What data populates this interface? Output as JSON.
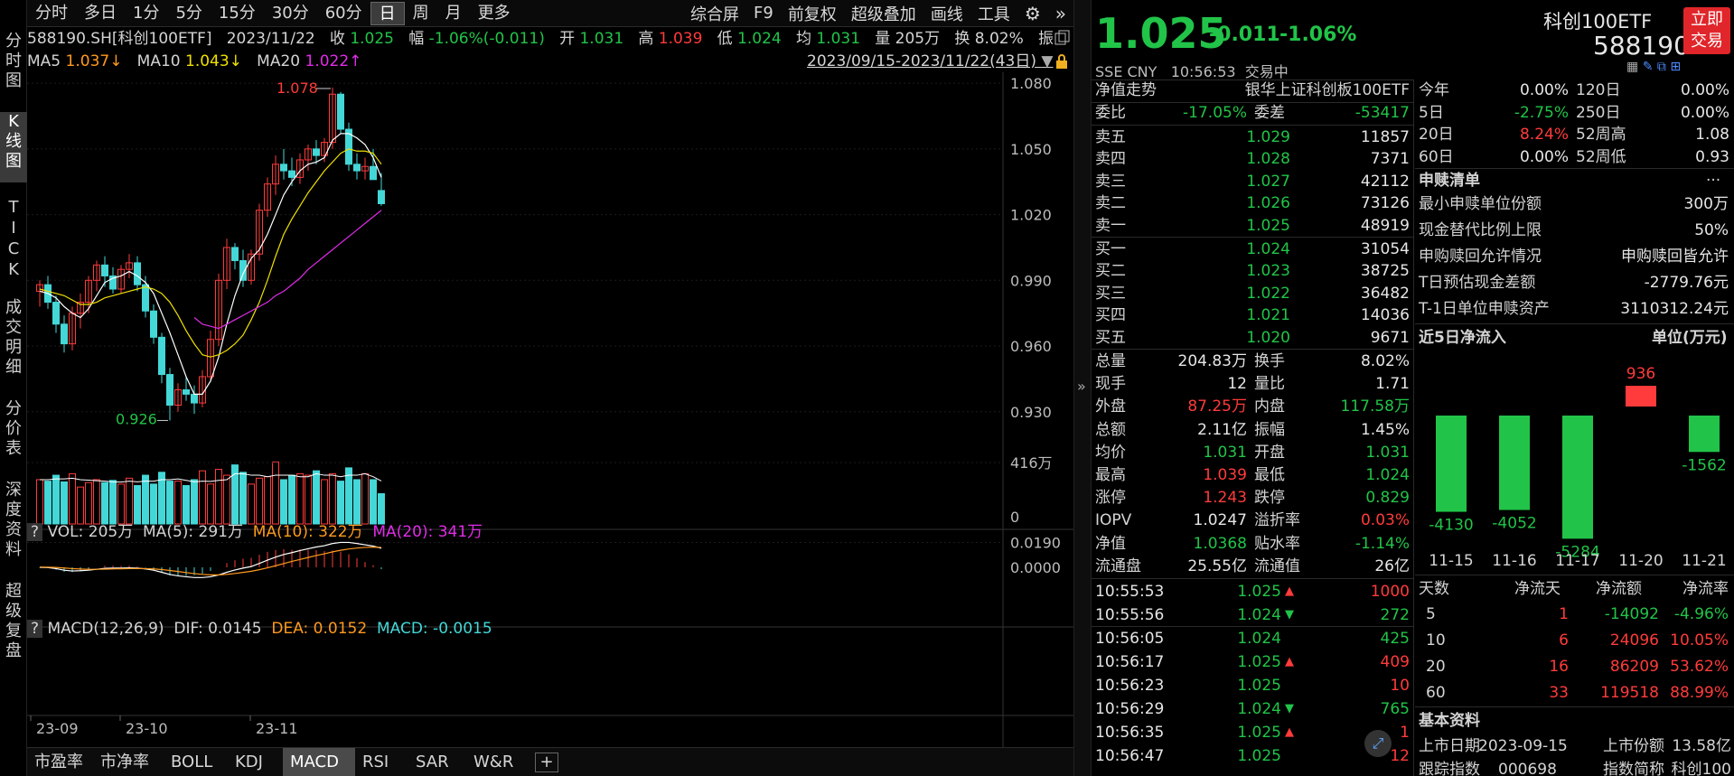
{
  "left_tabs": [
    "分时图",
    "K线图",
    "TICK",
    "成交明细",
    "分价表",
    "深度资料",
    "超级复盘"
  ],
  "top": {
    "periods": [
      "分时",
      "多日",
      "1分",
      "5分",
      "15分",
      "30分",
      "60分",
      "日",
      "周",
      "月",
      "更多"
    ],
    "active_period": "日",
    "tools": [
      "综合屏",
      "F9",
      "前复权",
      "超级叠加",
      "画线",
      "工具"
    ]
  },
  "info": {
    "code": "588190.SH[科创100ETF]",
    "date": "2023/11/22",
    "close_l": "收",
    "close": "1.025",
    "chg_l": "幅",
    "chg": "-1.06%(-0.011)",
    "open_l": "开",
    "open": "1.031",
    "high_l": "高",
    "high": "1.039",
    "low_l": "低",
    "low": "1.024",
    "avg_l": "均",
    "avg": "1.031",
    "vol_l": "量",
    "vol": "205万",
    "turn_l": "换",
    "turn": "8.02%",
    "amp_l": "振"
  },
  "ma_line": {
    "ma5_l": "MA5",
    "ma5": "1.037↓",
    "ma10_l": "MA10",
    "ma10": "1.043↓",
    "ma20_l": "MA20",
    "ma20": "1.022↑",
    "range": "2023/09/15-2023/11/22(43日)"
  },
  "price_axis": [
    "1.080",
    "1.050",
    "1.020",
    "0.990",
    "0.960",
    "0.930"
  ],
  "annot": {
    "high": "1.078",
    "low": "0.926"
  },
  "vol_panel": {
    "q": "?",
    "vol": "VOL: 205万",
    "ma5": "MA(5): 291万",
    "ma10": "MA(10): 322万",
    "ma20": "MA(20): 341万",
    "axis_top": "416万",
    "axis_zero": "0"
  },
  "macd_panel": {
    "q": "?",
    "label": "MACD(12,26,9)",
    "dif": "DIF: 0.0145",
    "dea": "DEA: 0.0152",
    "macd": "MACD: -0.0015",
    "axis_top": "0.0190",
    "axis_zero": "0.0000"
  },
  "x_axis": [
    "23-09",
    "23-10",
    "23-11"
  ],
  "bottom_tabs": [
    "市盈率",
    "市净率",
    "BOLL",
    "KDJ",
    "MACD",
    "RSI",
    "SAR",
    "W&R"
  ],
  "bottom_active": "MACD",
  "chart_data": {
    "type": "candlestick",
    "series_names": [
      "MA5",
      "MA10",
      "MA20"
    ],
    "candles": [
      {
        "o": 0.985,
        "h": 0.99,
        "l": 0.978,
        "c": 0.988
      },
      {
        "o": 0.988,
        "h": 0.992,
        "l": 0.977,
        "c": 0.98
      },
      {
        "o": 0.98,
        "h": 0.983,
        "l": 0.966,
        "c": 0.97
      },
      {
        "o": 0.97,
        "h": 0.974,
        "l": 0.957,
        "c": 0.961
      },
      {
        "o": 0.961,
        "h": 0.978,
        "l": 0.958,
        "c": 0.975
      },
      {
        "o": 0.975,
        "h": 0.984,
        "l": 0.968,
        "c": 0.98
      },
      {
        "o": 0.98,
        "h": 0.992,
        "l": 0.975,
        "c": 0.99
      },
      {
        "o": 0.99,
        "h": 0.999,
        "l": 0.985,
        "c": 0.997
      },
      {
        "o": 0.997,
        "h": 1.001,
        "l": 0.987,
        "c": 0.992
      },
      {
        "o": 0.992,
        "h": 0.996,
        "l": 0.984,
        "c": 0.986
      },
      {
        "o": 0.986,
        "h": 0.997,
        "l": 0.984,
        "c": 0.995
      },
      {
        "o": 0.995,
        "h": 1.002,
        "l": 0.991,
        "c": 0.998
      },
      {
        "o": 0.998,
        "h": 1.001,
        "l": 0.985,
        "c": 0.988
      },
      {
        "o": 0.988,
        "h": 0.992,
        "l": 0.973,
        "c": 0.976
      },
      {
        "o": 0.976,
        "h": 0.979,
        "l": 0.961,
        "c": 0.964
      },
      {
        "o": 0.964,
        "h": 0.966,
        "l": 0.943,
        "c": 0.947
      },
      {
        "o": 0.947,
        "h": 0.95,
        "l": 0.926,
        "c": 0.933
      },
      {
        "o": 0.933,
        "h": 0.943,
        "l": 0.93,
        "c": 0.94
      },
      {
        "o": 0.94,
        "h": 0.946,
        "l": 0.935,
        "c": 0.938
      },
      {
        "o": 0.938,
        "h": 0.942,
        "l": 0.929,
        "c": 0.934
      },
      {
        "o": 0.934,
        "h": 0.949,
        "l": 0.932,
        "c": 0.946
      },
      {
        "o": 0.946,
        "h": 0.967,
        "l": 0.944,
        "c": 0.963
      },
      {
        "o": 0.963,
        "h": 0.993,
        "l": 0.96,
        "c": 0.99
      },
      {
        "o": 0.99,
        "h": 1.009,
        "l": 0.986,
        "c": 1.005
      },
      {
        "o": 1.005,
        "h": 1.007,
        "l": 0.995,
        "c": 0.999
      },
      {
        "o": 0.999,
        "h": 1.004,
        "l": 0.987,
        "c": 0.99
      },
      {
        "o": 0.99,
        "h": 1.004,
        "l": 0.988,
        "c": 1.002
      },
      {
        "o": 1.002,
        "h": 1.025,
        "l": 0.999,
        "c": 1.022
      },
      {
        "o": 1.022,
        "h": 1.037,
        "l": 1.019,
        "c": 1.034
      },
      {
        "o": 1.034,
        "h": 1.047,
        "l": 1.029,
        "c": 1.043
      },
      {
        "o": 1.043,
        "h": 1.05,
        "l": 1.036,
        "c": 1.04
      },
      {
        "o": 1.04,
        "h": 1.046,
        "l": 1.033,
        "c": 1.037
      },
      {
        "o": 1.037,
        "h": 1.048,
        "l": 1.034,
        "c": 1.045
      },
      {
        "o": 1.045,
        "h": 1.052,
        "l": 1.04,
        "c": 1.05
      },
      {
        "o": 1.05,
        "h": 1.054,
        "l": 1.043,
        "c": 1.047
      },
      {
        "o": 1.047,
        "h": 1.055,
        "l": 1.044,
        "c": 1.053
      },
      {
        "o": 1.053,
        "h": 1.078,
        "l": 1.05,
        "c": 1.075
      },
      {
        "o": 1.075,
        "h": 1.076,
        "l": 1.057,
        "c": 1.059
      },
      {
        "o": 1.059,
        "h": 1.062,
        "l": 1.04,
        "c": 1.043
      },
      {
        "o": 1.043,
        "h": 1.048,
        "l": 1.036,
        "c": 1.04
      },
      {
        "o": 1.04,
        "h": 1.046,
        "l": 1.036,
        "c": 1.042
      },
      {
        "o": 1.042,
        "h": 1.05,
        "l": 1.038,
        "c": 1.036
      },
      {
        "o": 1.031,
        "h": 1.039,
        "l": 1.024,
        "c": 1.025
      }
    ],
    "ma5": [
      0.985,
      0.984,
      0.982,
      0.978,
      0.975,
      0.973,
      0.977,
      0.983,
      0.989,
      0.991,
      0.992,
      0.994,
      0.992,
      0.989,
      0.984,
      0.975,
      0.966,
      0.956,
      0.946,
      0.938,
      0.938,
      0.944,
      0.955,
      0.97,
      0.983,
      0.993,
      1.0,
      1.004,
      1.011,
      1.02,
      1.029,
      1.035,
      1.04,
      1.043,
      1.044,
      1.046,
      1.054,
      1.057,
      1.057,
      1.055,
      1.052,
      1.046,
      1.037
    ],
    "ma10": [
      0.986,
      0.985,
      0.984,
      0.983,
      0.981,
      0.979,
      0.979,
      0.98,
      0.982,
      0.983,
      0.984,
      0.985,
      0.986,
      0.987,
      0.986,
      0.984,
      0.98,
      0.974,
      0.967,
      0.961,
      0.956,
      0.955,
      0.956,
      0.958,
      0.961,
      0.965,
      0.972,
      0.98,
      0.99,
      1.001,
      1.011,
      1.018,
      1.024,
      1.03,
      1.035,
      1.04,
      1.044,
      1.048,
      1.05,
      1.049,
      1.049,
      1.048,
      1.043
    ],
    "ma20": [
      null,
      null,
      null,
      null,
      null,
      null,
      null,
      null,
      null,
      null,
      null,
      null,
      null,
      null,
      null,
      null,
      null,
      null,
      null,
      0.973,
      0.97,
      0.969,
      0.968,
      0.97,
      0.972,
      0.974,
      0.976,
      0.978,
      0.98,
      0.983,
      0.985,
      0.988,
      0.991,
      0.995,
      0.998,
      1.001,
      1.004,
      1.007,
      1.01,
      1.013,
      1.016,
      1.019,
      1.022
    ],
    "volume_wan": [
      300,
      290,
      330,
      285,
      340,
      250,
      280,
      300,
      280,
      295,
      270,
      310,
      260,
      330,
      270,
      350,
      290,
      290,
      260,
      300,
      360,
      270,
      370,
      330,
      400,
      350,
      270,
      310,
      320,
      420,
      300,
      330,
      340,
      330,
      360,
      300,
      340,
      290,
      380,
      300,
      340,
      300,
      205
    ],
    "vol_ma5_wan": [
      300,
      300,
      305,
      305,
      310,
      300,
      297,
      293,
      290,
      285,
      284,
      290,
      285,
      290,
      290,
      300,
      300,
      305,
      295,
      285,
      290,
      288,
      295,
      300,
      340,
      340,
      330,
      330,
      320,
      330,
      330,
      330,
      320,
      320,
      340,
      330,
      330,
      320,
      330,
      330,
      340,
      320,
      291
    ],
    "dif": [
      0.0,
      -0.0002,
      -0.001,
      -0.0022,
      -0.0028,
      -0.0026,
      -0.0022,
      -0.0015,
      -0.0008,
      -0.0006,
      -0.0006,
      -0.0004,
      -0.0006,
      -0.0012,
      -0.0022,
      -0.0038,
      -0.0055,
      -0.0065,
      -0.0072,
      -0.0078,
      -0.0078,
      -0.0072,
      -0.0058,
      -0.0038,
      -0.002,
      -0.0006,
      0.0006,
      0.003,
      0.0055,
      0.0078,
      0.0098,
      0.0112,
      0.0128,
      0.0142,
      0.0155,
      0.0165,
      0.0182,
      0.019,
      0.019,
      0.0182,
      0.0172,
      0.0162,
      0.0145
    ],
    "dea": [
      0.0002,
      0.0001,
      -0.0001,
      -0.0005,
      -0.001,
      -0.0013,
      -0.0015,
      -0.0015,
      -0.0014,
      -0.0012,
      -0.0011,
      -0.001,
      -0.0009,
      -0.001,
      -0.0012,
      -0.0017,
      -0.0024,
      -0.0032,
      -0.004,
      -0.0048,
      -0.0054,
      -0.0058,
      -0.0058,
      -0.0054,
      -0.0047,
      -0.0039,
      -0.003,
      -0.0018,
      -0.0004,
      0.0012,
      0.0029,
      0.0045,
      0.006,
      0.0075,
      0.009,
      0.0103,
      0.0118,
      0.013,
      0.014,
      0.0147,
      0.0152,
      0.0154,
      0.0152
    ]
  },
  "quote": {
    "price": "1.025",
    "chg": "-0.011",
    "pct": "-1.06%",
    "name": "科创100ETF",
    "code": "588190",
    "btn": "立即交易",
    "exch": "SSE CNY",
    "time": "10:56:53",
    "status": "交易中",
    "nav_trend": "净值走势",
    "index_name": "银华上证科创板100ETF"
  },
  "ratio": {
    "label1": "委比",
    "v1": "-17.05%",
    "label2": "委差",
    "v2": "-53417"
  },
  "asks": [
    {
      "l": "卖五",
      "p": "1.029",
      "v": "11857"
    },
    {
      "l": "卖四",
      "p": "1.028",
      "v": "7371"
    },
    {
      "l": "卖三",
      "p": "1.027",
      "v": "42112"
    },
    {
      "l": "卖二",
      "p": "1.026",
      "v": "73126"
    },
    {
      "l": "卖一",
      "p": "1.025",
      "v": "48919"
    }
  ],
  "bids": [
    {
      "l": "买一",
      "p": "1.024",
      "v": "31054"
    },
    {
      "l": "买二",
      "p": "1.023",
      "v": "38725"
    },
    {
      "l": "买三",
      "p": "1.022",
      "v": "36482"
    },
    {
      "l": "买四",
      "p": "1.021",
      "v": "14036"
    },
    {
      "l": "买五",
      "p": "1.020",
      "v": "9671"
    }
  ],
  "stats": [
    {
      "l1": "总量",
      "v1": "204.83万",
      "c1": "white",
      "l2": "换手",
      "v2": "8.02%",
      "c2": "white"
    },
    {
      "l1": "现手",
      "v1": "12",
      "c1": "white",
      "l2": "量比",
      "v2": "1.71",
      "c2": "white"
    },
    {
      "l1": "外盘",
      "v1": "87.25万",
      "c1": "red",
      "l2": "内盘",
      "v2": "117.58万",
      "c2": "green"
    },
    {
      "l1": "总额",
      "v1": "2.11亿",
      "c1": "white",
      "l2": "振幅",
      "v2": "1.45%",
      "c2": "white"
    },
    {
      "l1": "均价",
      "v1": "1.031",
      "c1": "green",
      "l2": "开盘",
      "v2": "1.031",
      "c2": "green"
    },
    {
      "l1": "最高",
      "v1": "1.039",
      "c1": "red",
      "l2": "最低",
      "v2": "1.024",
      "c2": "green"
    },
    {
      "l1": "涨停",
      "v1": "1.243",
      "c1": "red",
      "l2": "跌停",
      "v2": "0.829",
      "c2": "green"
    },
    {
      "l1": "IOPV",
      "v1": "1.0247",
      "c1": "white",
      "l2": "溢折率",
      "v2": "0.03%",
      "c2": "red"
    },
    {
      "l1": "净值",
      "v1": "1.0368",
      "c1": "green",
      "l2": "贴水率",
      "v2": "-1.14%",
      "c2": "green"
    },
    {
      "l1": "流通盘",
      "v1": "25.55亿",
      "c1": "white",
      "l2": "流通值",
      "v2": "26亿",
      "c2": "white"
    }
  ],
  "ticks": [
    {
      "t": "10:55:53",
      "p": "1.025",
      "d": "up",
      "v": "1000",
      "vc": "red"
    },
    {
      "t": "10:55:56",
      "p": "1.024",
      "d": "down",
      "v": "272",
      "vc": "green"
    },
    {
      "t": "10:56:05",
      "p": "1.024",
      "d": "",
      "v": "425",
      "vc": "green"
    },
    {
      "t": "10:56:17",
      "p": "1.025",
      "d": "up",
      "v": "409",
      "vc": "red"
    },
    {
      "t": "10:56:23",
      "p": "1.025",
      "d": "",
      "v": "10",
      "vc": "red"
    },
    {
      "t": "10:56:29",
      "p": "1.024",
      "d": "down",
      "v": "765",
      "vc": "green"
    },
    {
      "t": "10:56:35",
      "p": "1.025",
      "d": "up",
      "v": "1",
      "vc": "red"
    },
    {
      "t": "10:56:47",
      "p": "1.025",
      "d": "",
      "v": "12",
      "vc": "red"
    }
  ],
  "perf": [
    {
      "l": "今年",
      "v": "0.00%",
      "c": "white",
      "l2": "120日",
      "v2": "0.00%",
      "c2": "white"
    },
    {
      "l": "5日",
      "v": "-2.75%",
      "c": "green",
      "l2": "250日",
      "v2": "0.00%",
      "c2": "white"
    },
    {
      "l": "20日",
      "v": "8.24%",
      "c": "red",
      "l2": "52周高",
      "v2": "1.08",
      "c2": "white"
    },
    {
      "l": "60日",
      "v": "0.00%",
      "c": "white",
      "l2": "52周低",
      "v2": "0.93",
      "c2": "white"
    }
  ],
  "redeem": {
    "title": "申赎清单",
    "more": "···",
    "rows": [
      {
        "l": "最小申赎单位份额",
        "v": "300万"
      },
      {
        "l": "现金替代比例上限",
        "v": "50%"
      },
      {
        "l": "申购赎回允许情况",
        "v": "申购赎回皆允许"
      },
      {
        "l": "T日预估现金差额",
        "v": "-2779.76元"
      },
      {
        "l": "T-1日单位申赎资产",
        "v": "3110312.24元"
      }
    ]
  },
  "netflow": {
    "title": "近5日净流入",
    "unit": "单位(万元)",
    "days": [
      "11-15",
      "11-16",
      "11-17",
      "11-20",
      "11-21"
    ],
    "values": [
      -4130,
      -4052,
      -5284,
      936,
      -1562
    ],
    "labels": [
      "-4130",
      "-4052",
      "-5284",
      "936",
      "-1562"
    ]
  },
  "flow_table": {
    "headers": [
      "天数",
      "净流天",
      "净流额",
      "净流率"
    ],
    "rows": [
      {
        "d": "5",
        "n": "1",
        "a": "-14092",
        "r": "-4.96%",
        "ac": "green"
      },
      {
        "d": "10",
        "n": "6",
        "a": "24096",
        "r": "10.05%",
        "ac": "red"
      },
      {
        "d": "20",
        "n": "16",
        "a": "86209",
        "r": "53.62%",
        "ac": "red"
      },
      {
        "d": "60",
        "n": "33",
        "a": "119518",
        "r": "88.99%",
        "ac": "red"
      }
    ]
  },
  "basic": {
    "title": "基本资料",
    "list_date_l": "上市日期",
    "list_date": "2023-09-15",
    "shares_l": "上市份额",
    "shares": "13.58亿",
    "track_l": "跟踪指数",
    "track": "000698",
    "abbr_l": "指数简称",
    "abbr": "科创100"
  }
}
